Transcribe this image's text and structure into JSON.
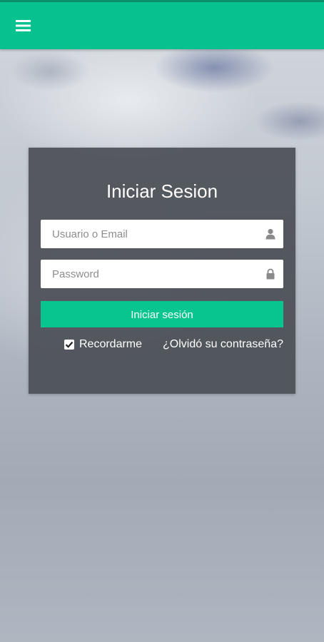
{
  "app_bar": {
    "menu_icon": "hamburger-menu-icon",
    "color": "#07c28e"
  },
  "login": {
    "title": "Iniciar Sesion",
    "username": {
      "placeholder": "Usuario o Email",
      "value": "",
      "icon": "user-icon"
    },
    "password": {
      "placeholder": "Password",
      "value": "",
      "icon": "lock-icon"
    },
    "submit_label": "Iniciar sesión",
    "remember_label": "Recordarme",
    "remember_checked": true,
    "forgot_label": "¿Olvidó su contraseña?"
  }
}
